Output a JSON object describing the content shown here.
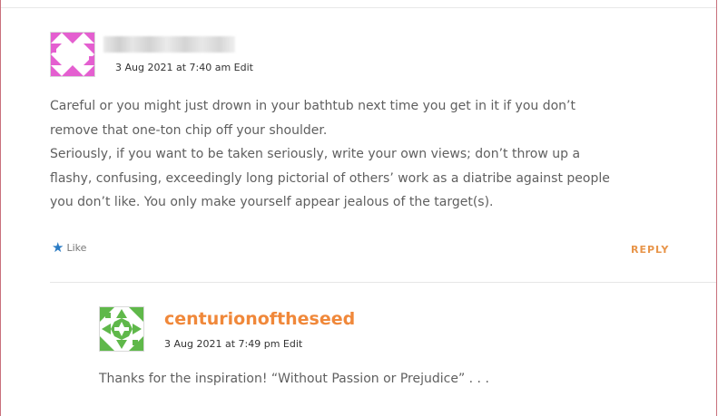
{
  "comment1": {
    "author": "",
    "date": "3 Aug 2021 at 7:40 am",
    "edit_label": "Edit",
    "paragraphs": [
      "Careful or you might just drown in your bathtub next time you get in it if you don’t remove that one-ton chip off your shoulder.",
      "Seriously, if you want to be taken seriously, write your own views; don’t throw up a flashy, confusing, exceedingly long pictorial of others’ work as a diatribe against people you don’t like. You only make yourself appear jealous of the target(s)."
    ],
    "like_label": "Like",
    "reply_label": "REPLY"
  },
  "comment2": {
    "author": "centurionoftheseed",
    "date": "3 Aug 2021 at 7:49 pm",
    "edit_label": "Edit",
    "text": "Thanks for the inspiration! “Without Passion or Prejudice” . . ."
  },
  "colors": {
    "accent": "#f0883a",
    "reply": "#e8954a",
    "like_star": "#2a7bc4",
    "frame": "#c9707c",
    "avatar1": "#e45fd0",
    "avatar2": "#5fb84a"
  }
}
